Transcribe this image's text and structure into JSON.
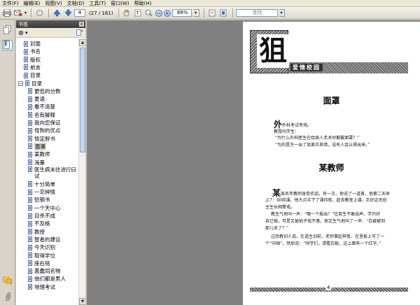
{
  "menu": [
    "文件(F)",
    "编辑(E)",
    "视图(V)",
    "文档(D)",
    "工具(T)",
    "窗口(W)",
    "帮助(H)"
  ],
  "toolbar": {
    "page_current": "4",
    "page_count": "(27 / 161)",
    "zoom": "88%",
    "find_placeholder": "查找"
  },
  "icons": {
    "print": "printer-icon",
    "email": "email-icon",
    "prev": "arrow-up-icon",
    "next": "arrow-down-icon",
    "zoom_out": "minus-icon",
    "zoom_in": "plus-icon"
  },
  "panel": {
    "title": "书签",
    "close": "x",
    "options": "▾"
  },
  "bookmarks": [
    {
      "label": "封面",
      "level": 0
    },
    {
      "label": "书名",
      "level": 0
    },
    {
      "label": "版权",
      "level": 0
    },
    {
      "label": "前言",
      "level": 0
    },
    {
      "label": "目录",
      "level": 0
    },
    {
      "label": "目录",
      "level": 0,
      "expanded": true
    },
    {
      "label": "更低的分数",
      "level": 1
    },
    {
      "label": "夏语",
      "level": 1
    },
    {
      "label": "看不清楚",
      "level": 1
    },
    {
      "label": "名有解释",
      "level": 1
    },
    {
      "label": "我向您保证",
      "level": 1
    },
    {
      "label": "母狗的优点",
      "level": 1
    },
    {
      "label": "情定胖书",
      "level": 1
    },
    {
      "label": "面罩",
      "level": 1,
      "selected": true
    },
    {
      "label": "某教师",
      "level": 1
    },
    {
      "label": "海量",
      "level": 1
    },
    {
      "label": "医生病末往进行曰试",
      "level": 1,
      "two_line": true
    },
    {
      "label": "十分简单",
      "level": 1
    },
    {
      "label": "一见钟情",
      "level": 1
    },
    {
      "label": "铅钢书",
      "level": 1
    },
    {
      "label": "一个天中心",
      "level": 1
    },
    {
      "label": "自杀不成",
      "level": 1
    },
    {
      "label": "不及格",
      "level": 1
    },
    {
      "label": "教授",
      "level": 1
    },
    {
      "label": "智者的建议",
      "level": 1
    },
    {
      "label": "今天识别",
      "level": 1
    },
    {
      "label": "取得学位",
      "level": 1
    },
    {
      "label": "座右铭",
      "level": 1
    },
    {
      "label": "愚蠢同名物",
      "level": 1
    },
    {
      "label": "他们都是男人",
      "level": 1
    },
    {
      "label": "地理考试",
      "level": 1
    }
  ],
  "document": {
    "banner_char": "狙",
    "banner_text": "爱情校园",
    "section1_title": "面罩",
    "section1_lines": [
      "外科考试考场。",
      "教授问学生：",
      "“为什么外科医生在给病人手术时都戴面罩？”",
      "“为的是万一出了现离炎差错，没有人会认得出来。”"
    ],
    "section2_title": "某教师",
    "section2_lines": [
      "某名年教师身受欢迎。有一次，他说了一道首，他第二天早",
      "上7：40前课。他大点半下了课待就，赶去教室上课。正好这天班",
      "主生长相警戒。",
      "教生气地叫一声：“哪一个报出？”往目生不敢出声，学只好",
      "自已掉，可是又被掐子找不落，他又生气地叫了一声：“白被被到",
      "那儿去了？”",
      "过后教训人说，在语生训前，老师事起神宽，在里板上写了一",
      "个“中国”。然后说：“同学们，请看白板，这上面有一个红字。”"
    ],
    "page_number": "4"
  }
}
